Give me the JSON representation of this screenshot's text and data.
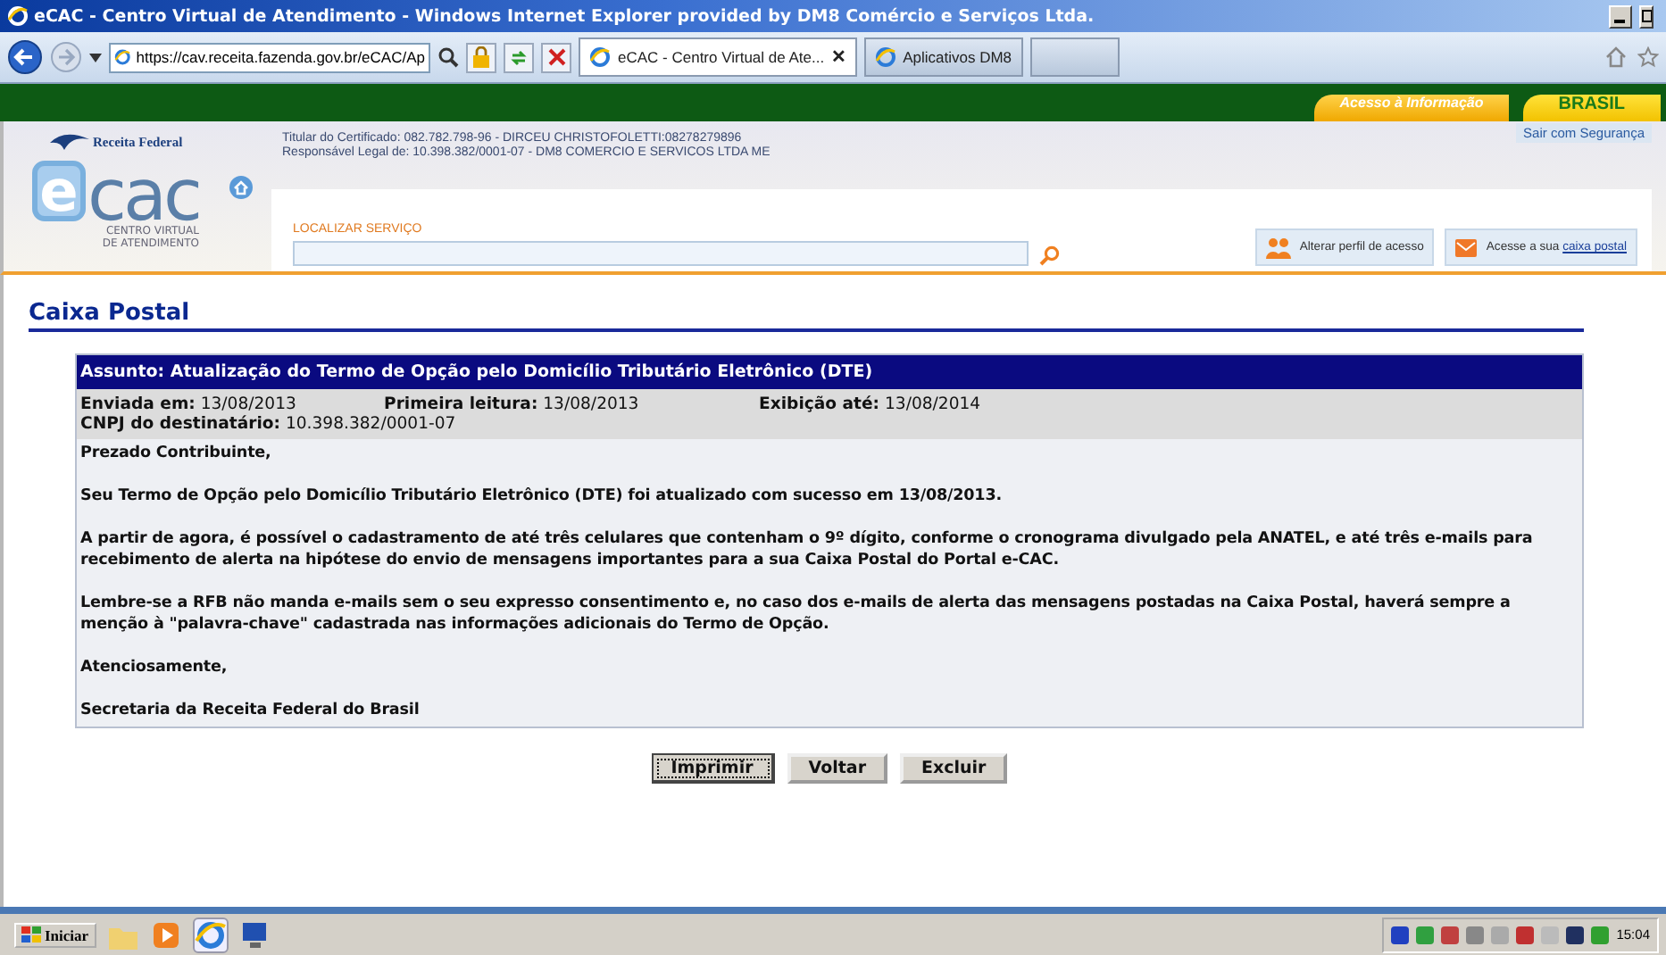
{
  "window": {
    "title": "eCAC - Centro Virtual de Atendimento - Windows Internet Explorer provided by DM8 Comércio e Serviços Ltda."
  },
  "browser": {
    "address": "https://cav.receita.fazenda.gov.br/eCAC/Ap",
    "tabs": [
      {
        "label": "eCAC - Centro Virtual de Ate...",
        "selected": true,
        "close": "✕"
      },
      {
        "label": "Aplicativos DM8",
        "selected": false
      }
    ]
  },
  "gov_bar": {
    "links": [
      "Acesso à Informação",
      "BRASIL"
    ]
  },
  "header": {
    "brand": "Receita Federal",
    "certificate_lines": [
      "Titular do Certificado: 082.782.798-96 - DIRCEU CHRISTOFOLETTI:08278279896",
      "Responsável Legal de: 10.398.382/0001-07 - DM8 COMERCIO E SERVICOS LTDA ME"
    ],
    "logout": "Sair com Segurança",
    "logo_letter": "e",
    "logo_text": "cac",
    "logo_subtitle": [
      "CENTRO VIRTUAL",
      "DE ATENDIMENTO"
    ],
    "search_label": "LOCALIZAR SERVIÇO",
    "actions": [
      {
        "kind": "profile",
        "label": "Alterar perfil de acesso"
      },
      {
        "kind": "mail",
        "label": "Acesse a sua",
        "link": "caixa postal"
      }
    ]
  },
  "page": {
    "title": "Caixa Postal"
  },
  "message": {
    "subject": "Assunto: Atualização do Termo de Opção pelo Domicílio Tributário Eletrônico (DTE)",
    "meta": [
      "**Enviada em:** 13/08/2013",
      "**Primeira leitura:** 13/08/2013",
      "**Exibição até:** 13/08/2014"
    ],
    "recipient": "**CNPJ do destinatário:** 10.398.382/0001-07",
    "paragraphs": [
      "Prezado Contribuinte,",
      "Seu Termo de Opção pelo Domicílio Tributário Eletrônico (DTE) foi atualizado com sucesso em 13/08/2013.",
      "A partir de agora, é possível o cadastramento de até três celulares que contenham o 9º dígito, conforme o cronograma divulgado pela ANATEL, e até três e-mails para recebimento de alerta na hipótese do envio de mensagens importantes para a sua Caixa Postal do Portal e-CAC.",
      "Lembre-se a RFB não manda e-mails sem o seu expresso consentimento e, no caso dos e-mails de alerta das mensagens postadas na Caixa Postal, haverá sempre a menção à \"palavra-chave\" cadastrada nas informações adicionais do Termo de Opção.",
      "Atenciosamente,",
      "Secretaria da Receita Federal do Brasil"
    ]
  },
  "buttons": [
    {
      "label": "Imprimir",
      "focused": true
    },
    {
      "label": "Voltar",
      "focused": false
    },
    {
      "label": "Excluir",
      "focused": false
    }
  ],
  "taskbar": {
    "start": "Iniciar",
    "clock": "15:04"
  }
}
